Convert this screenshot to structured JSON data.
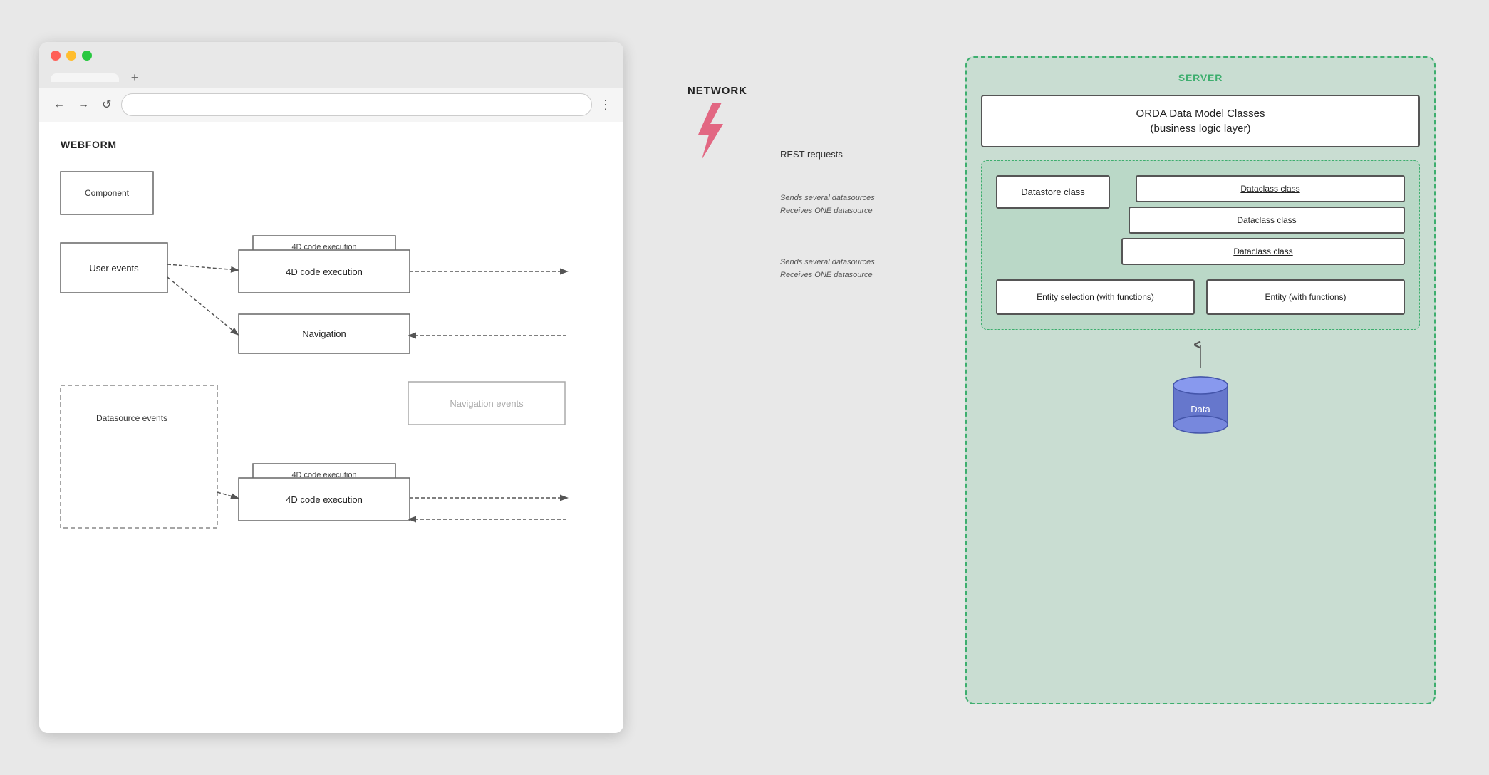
{
  "browser": {
    "tab_label": "",
    "address_bar_placeholder": "",
    "nav_back": "←",
    "nav_forward": "→",
    "nav_refresh": "↺",
    "nav_menu": "⋮",
    "tab_plus": "+"
  },
  "webform": {
    "section_label": "WEBFORM",
    "component_label": "Component",
    "user_events_label": "User events",
    "code_exec_label_1": "4D code execution",
    "code_exec_label_1_tab": "4D code execution",
    "navigation_label": "Navigation",
    "datasource_events_label": "Datasource events",
    "navigation_events_label": "Navigation events",
    "code_exec_label_2_tab": "4D code execution",
    "code_exec_label_2": "4D code execution"
  },
  "network": {
    "section_label": "NETWORK",
    "rest_requests": "REST requests",
    "sends_several_1": "Sends several datasources",
    "receives_one_1": "Receives ONE datasource",
    "sends_several_2": "Sends several datasources",
    "receives_one_2": "Receives ONE datasource"
  },
  "server": {
    "section_label": "SERVER",
    "orda_title": "ORDA Data Model Classes\n(business logic layer)",
    "datastore_label": "Datastore class",
    "dataclass_1": "Dataclass class",
    "dataclass_2": "Dataclass class",
    "dataclass_3": "Dataclass class",
    "entity_selection": "Entity selection (with functions)",
    "entity": "Entity (with functions)",
    "data_label": "Data",
    "accent_color": "#3dae6e",
    "lightning_color": "#e05070"
  }
}
